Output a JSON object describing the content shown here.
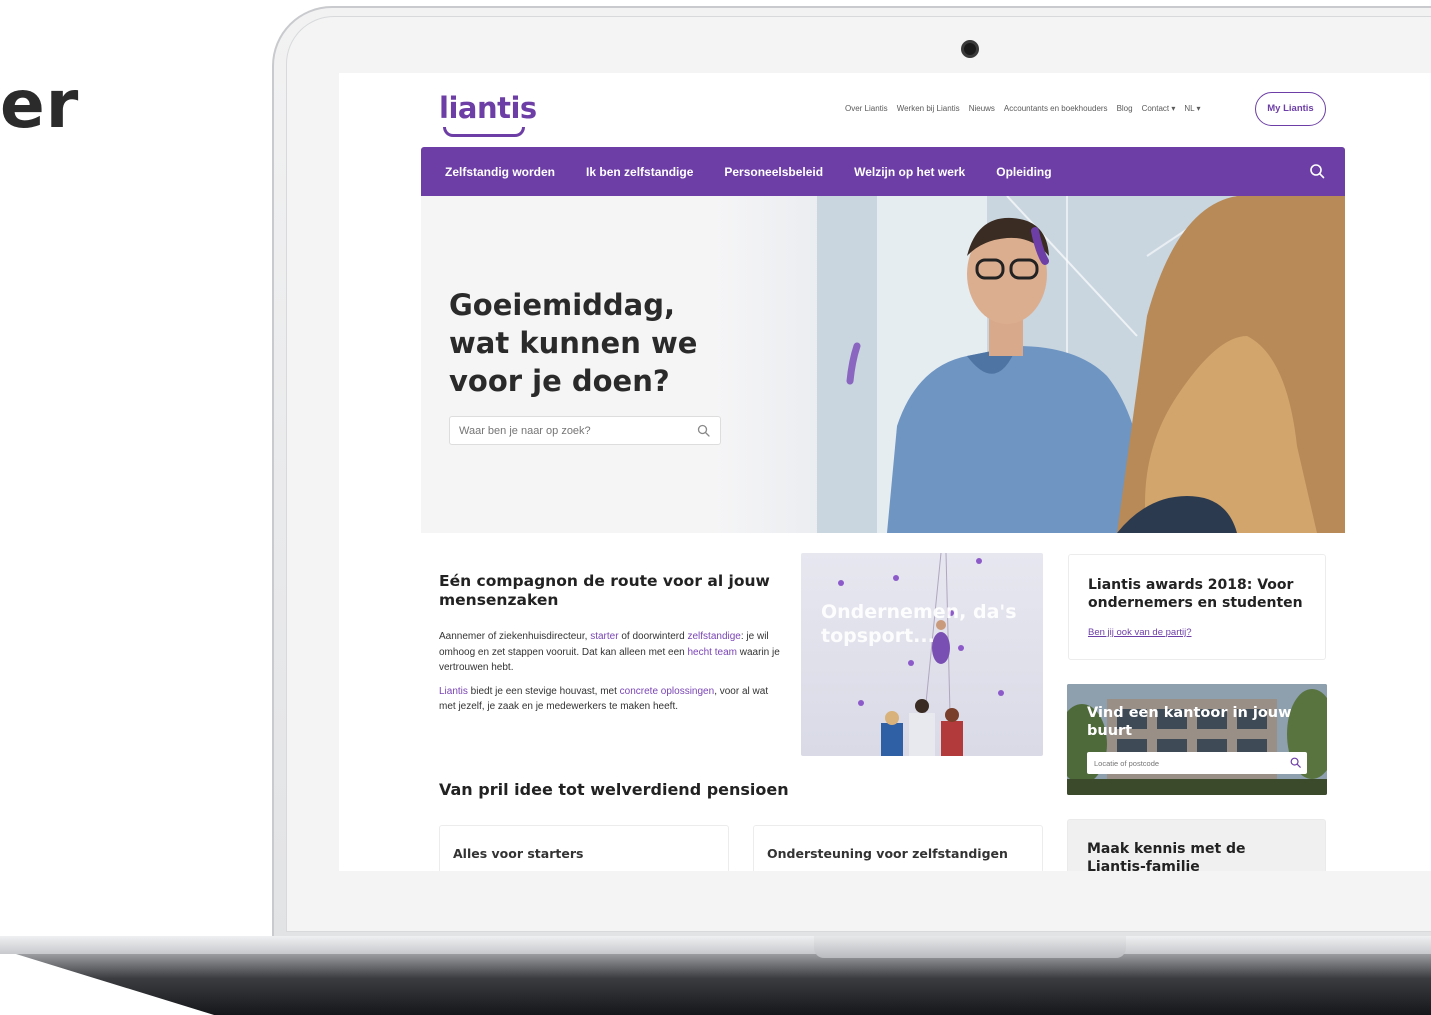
{
  "slide": {
    "partial_title": "er"
  },
  "site": {
    "logo": "liantis",
    "top_links": [
      "Over Liantis",
      "Werken bij Liantis",
      "Nieuws",
      "Accountants en boekhouders",
      "Blog",
      "Contact ▾",
      "NL ▾"
    ],
    "account_button": "My Liantis",
    "main_nav": [
      "Zelfstandig worden",
      "Ik ben zelfstandige",
      "Personeelsbeleid",
      "Welzijn op het werk",
      "Opleiding"
    ]
  },
  "hero": {
    "title": "Goeiemiddag, wat kunnen we voor je doen?",
    "search_placeholder": "Waar ben je naar op zoek?"
  },
  "intro": {
    "title": "Eén compagnon de route voor al jouw mensenzaken",
    "p1_a": "Aannemer of ziekenhuisdirecteur, ",
    "p1_link1": "starter",
    "p1_b": " of doorwinterd ",
    "p1_link2": "zelfstandige",
    "p1_c": ": je wil omhoog en zet stappen vooruit. Dat kan alleen met een ",
    "p1_link3": "hecht team",
    "p1_d": " waarin je vertrouwen hebt.",
    "p2_link1": "Liantis",
    "p2_a": " biedt je een stevige houvast, met ",
    "p2_link2": "concrete oplossingen",
    "p2_b": ", voor al wat met jezelf, je zaak en je medewerkers te maken heeft."
  },
  "climbing_card": {
    "title": "Ondernemen, da's topsport..."
  },
  "awards_card": {
    "title": "Liantis awards 2018: Voor ondernemers en studenten",
    "link": "Ben jij ook van de partij?"
  },
  "office_card": {
    "title": "Vind een kantoor in jouw buurt",
    "placeholder": "Locatie of postcode"
  },
  "section2": {
    "title": "Van pril idee tot welverdiend pensioen",
    "cards": [
      "Alles voor starters",
      "Ondersteuning voor zelfstandigen"
    ]
  },
  "family_card": {
    "title": "Maak kennis met de Liantis-familie"
  },
  "colors": {
    "brand_purple": "#6d3fa6",
    "text_dark": "#222222"
  }
}
